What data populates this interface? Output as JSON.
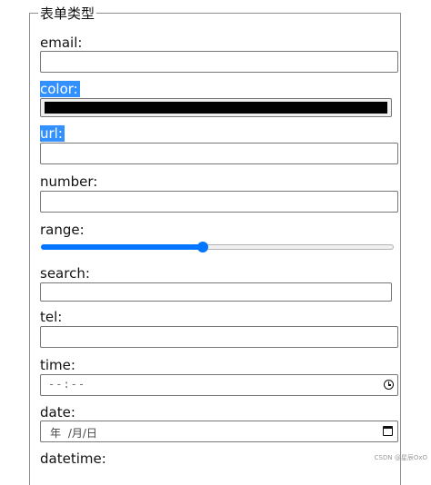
{
  "form": {
    "legend": "表单类型",
    "fields": {
      "email": {
        "label": "email:",
        "value": ""
      },
      "color": {
        "label": "color:",
        "value": "#000000"
      },
      "url": {
        "label": "url:",
        "value": ""
      },
      "number": {
        "label": "number:",
        "value": ""
      },
      "range": {
        "label": "range:",
        "value_fraction": 0.46
      },
      "search": {
        "label": "search:",
        "value": ""
      },
      "tel": {
        "label": "tel:",
        "value": ""
      },
      "time": {
        "label": "time:",
        "placeholder": "--:--"
      },
      "date": {
        "label": "date:",
        "placeholder": "年 /月/日"
      },
      "datetime": {
        "label": "datetime:"
      }
    }
  },
  "colors": {
    "accent": "#0075ff",
    "selection": "#3390ff",
    "border": "#767676"
  },
  "watermark": "CSDN @星辰OxO"
}
